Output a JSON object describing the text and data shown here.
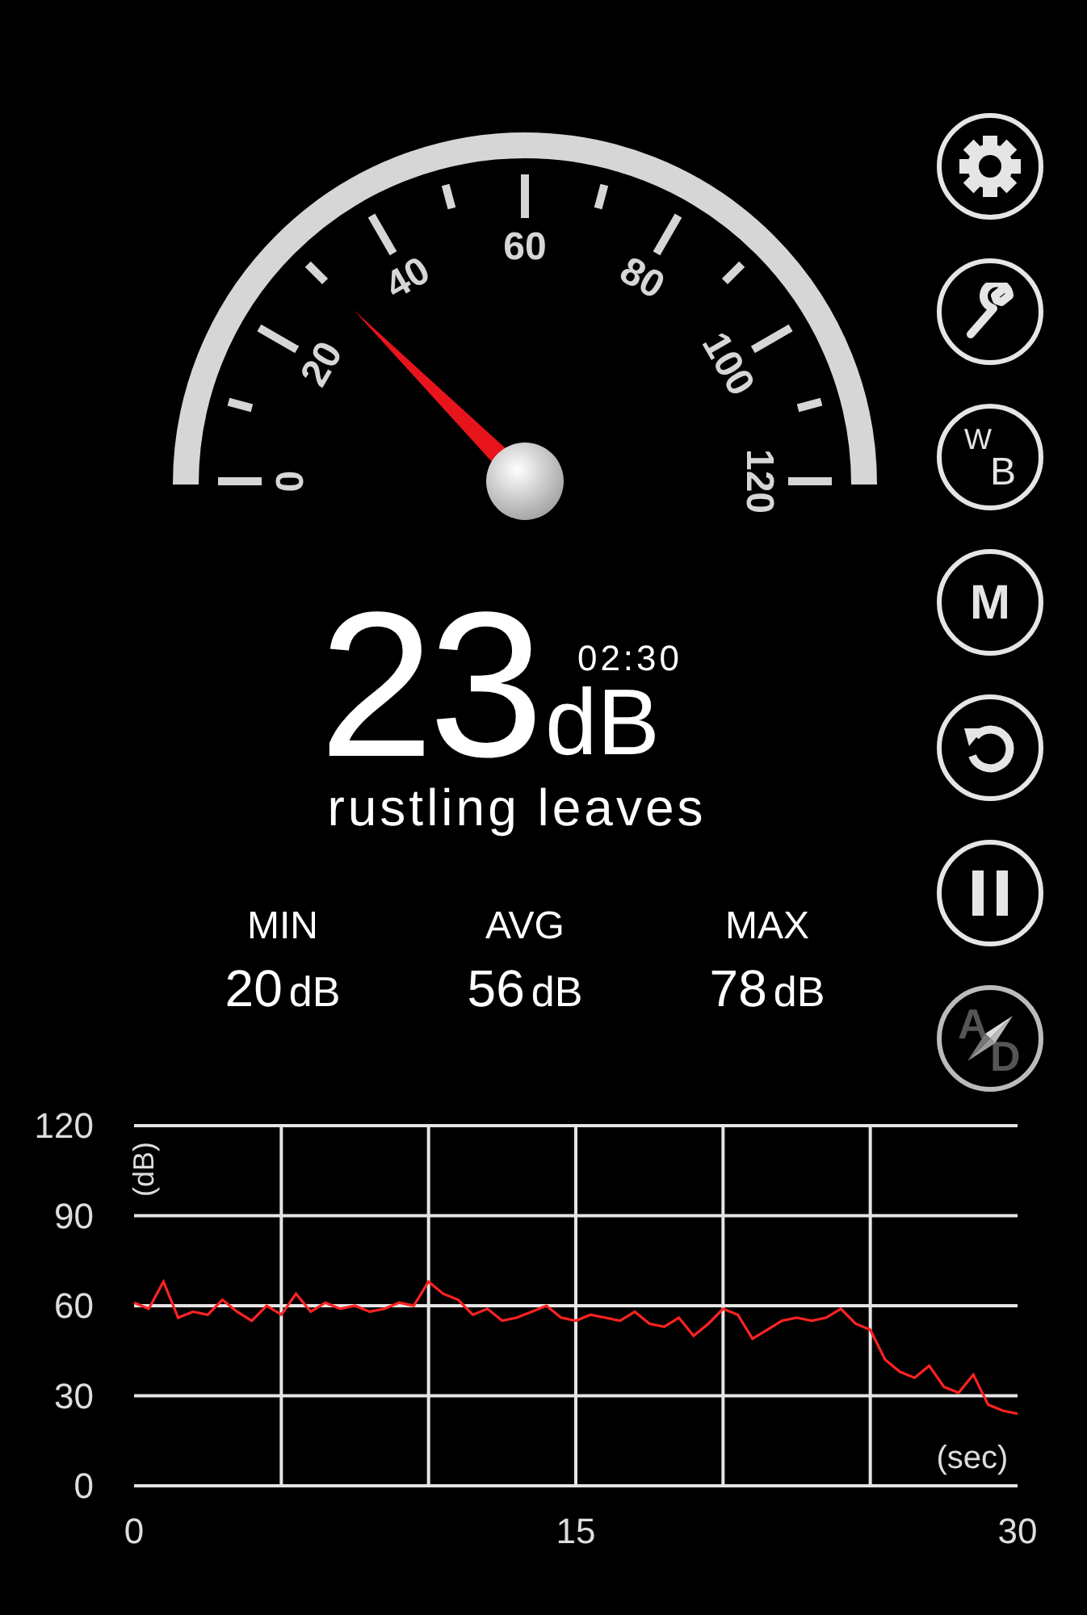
{
  "gauge": {
    "scale_labels": [
      "0",
      "20",
      "40",
      "60",
      "80",
      "100",
      "120"
    ]
  },
  "readout": {
    "value": "23",
    "unit": "dB",
    "timer": "02:30",
    "description": "rustling leaves"
  },
  "stats": [
    {
      "label": "MIN",
      "value": "20",
      "unit": "dB"
    },
    {
      "label": "AVG",
      "value": "56",
      "unit": "dB"
    },
    {
      "label": "MAX",
      "value": "78",
      "unit": "dB"
    }
  ],
  "side_buttons": [
    {
      "kind": "settings",
      "disabled": false
    },
    {
      "kind": "wrench",
      "disabled": false
    },
    {
      "kind": "letters",
      "letters": [
        "W",
        "B"
      ],
      "disabled": false
    },
    {
      "kind": "letter",
      "text": "M",
      "disabled": false
    },
    {
      "kind": "reset",
      "disabled": false
    },
    {
      "kind": "pause",
      "disabled": false
    },
    {
      "kind": "compass",
      "letters": [
        "A",
        "D"
      ],
      "disabled": true
    }
  ],
  "chart": {
    "chart_data": {
      "type": "line",
      "xlabel": "(sec)",
      "ylabel": "(dB)",
      "xlim": [
        0,
        30
      ],
      "ylim": [
        0,
        120
      ],
      "xticks": [
        0,
        15,
        30
      ],
      "yticks": [
        0,
        30,
        60,
        90,
        120
      ],
      "grid": true,
      "x": [
        0,
        0.5,
        1,
        1.5,
        2,
        2.5,
        3,
        3.5,
        4,
        4.5,
        5,
        5.5,
        6,
        6.5,
        7,
        7.5,
        8,
        8.5,
        9,
        9.5,
        10,
        10.5,
        11,
        11.5,
        12,
        12.5,
        13,
        13.5,
        14,
        14.5,
        15,
        15.5,
        16,
        16.5,
        17,
        17.5,
        18,
        18.5,
        19,
        19.5,
        20,
        20.5,
        21,
        21.5,
        22,
        22.5,
        23,
        23.5,
        24,
        24.5,
        25,
        25.5,
        26,
        26.5,
        27,
        27.5,
        28,
        28.5,
        29,
        29.5,
        30
      ],
      "series": [
        {
          "color": "#ff2222",
          "values": [
            61,
            59,
            68,
            56,
            58,
            57,
            62,
            58,
            55,
            60,
            57,
            64,
            58,
            61,
            59,
            60,
            58,
            59,
            61,
            60,
            68,
            64,
            62,
            57,
            59,
            55,
            56,
            58,
            60,
            56,
            55,
            57,
            56,
            55,
            58,
            54,
            53,
            56,
            50,
            54,
            59,
            57,
            49,
            52,
            55,
            56,
            55,
            56,
            59,
            54,
            52,
            42,
            38,
            36,
            40,
            33,
            31,
            37,
            27,
            25,
            24
          ]
        }
      ]
    }
  }
}
